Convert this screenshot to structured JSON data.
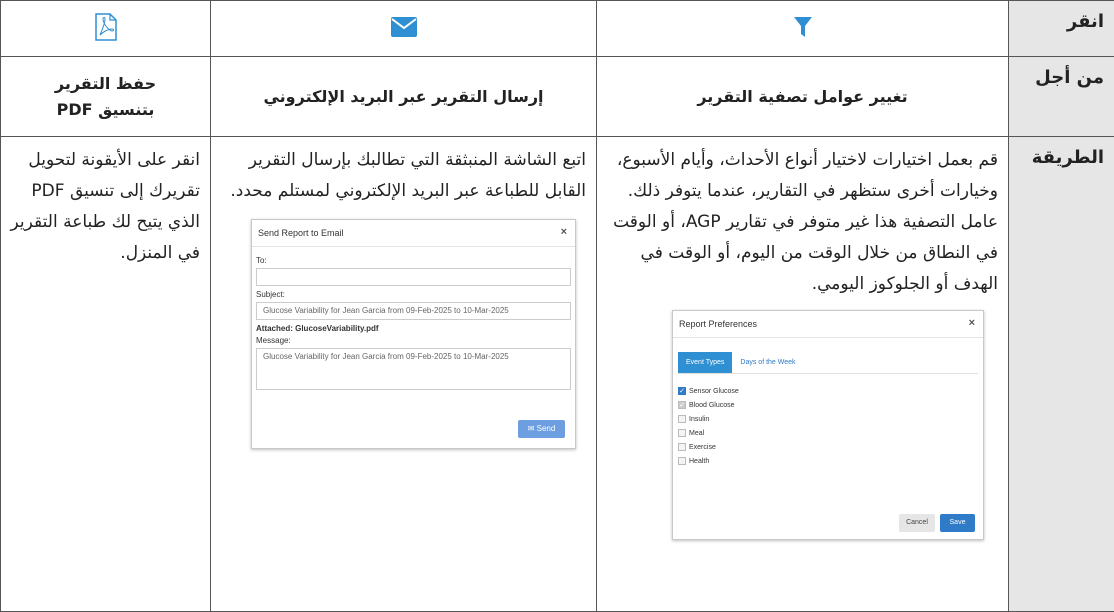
{
  "headers": {
    "click": "انقر",
    "purpose": "من أجل",
    "method": "الطريقة"
  },
  "icons": {
    "filter": "filter-icon",
    "email": "envelope-icon",
    "pdf": "pdf-icon",
    "accent": "#2f8fd3"
  },
  "purpose": {
    "filter": "تغيير عوامل تصفية التقرير",
    "email": "إرسال التقرير عبر البريد الإلكتروني",
    "pdf_line1": "حفظ التقرير",
    "pdf_line2": "بتنسيق PDF"
  },
  "method": {
    "filter": "قم بعمل اختيارات لاختيار أنواع الأحداث، وأيام الأسبوع، وخيارات أخرى ستظهر في التقارير، عندما يتوفر ذلك. عامل التصفية هذا غير متوفر في تقارير AGP، أو الوقت في النطاق من خلال الوقت من اليوم، أو الوقت في الهدف أو الجلوكوز اليومي.",
    "email": "اتبع الشاشة المنبثقة التي تطالبك بإرسال التقرير القابل للطباعة عبر البريد الإلكتروني لمستلم محدد.",
    "pdf": "انقر على الأيقونة لتحويل تقريرك إلى تنسيق PDF الذي يتيح لك طباعة التقرير في المنزل."
  },
  "email_dialog": {
    "title": "Send Report to Email",
    "close": "×",
    "to_label": "To:",
    "to_value": "",
    "subject_label": "Subject:",
    "subject_value": "Glucose Variability for Jean Garcia from 09-Feb-2025 to 10-Mar-2025",
    "attached": "Attached: GlucoseVariability.pdf",
    "message_label": "Message:",
    "message_value": "Glucose Variability for Jean Garcia from 09-Feb-2025 to 10-Mar-2025",
    "send_label": "Send"
  },
  "prefs_dialog": {
    "title": "Report Preferences",
    "close": "×",
    "tabs": [
      "Event Types",
      "Days of the Week"
    ],
    "options": [
      {
        "label": "Sensor Glucose",
        "state": "checked"
      },
      {
        "label": "Blood Glucose",
        "state": "checked-disabled"
      },
      {
        "label": "Insulin",
        "state": "unchecked"
      },
      {
        "label": "Meal",
        "state": "unchecked"
      },
      {
        "label": "Exercise",
        "state": "unchecked"
      },
      {
        "label": "Health",
        "state": "unchecked"
      }
    ],
    "cancel_label": "Cancel",
    "save_label": "Save"
  }
}
